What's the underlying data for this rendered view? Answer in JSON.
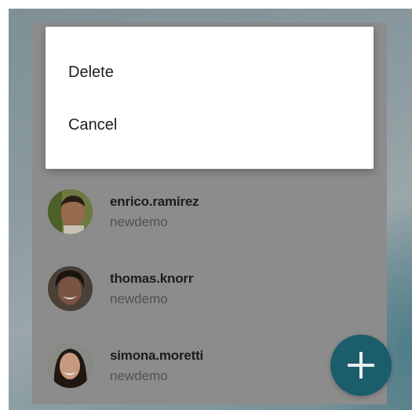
{
  "context_menu": {
    "items": [
      {
        "label": "Delete"
      },
      {
        "label": "Cancel"
      }
    ]
  },
  "users": [
    {
      "name": "enrico.ramirez",
      "org": "newdemo",
      "avatar": "man-short-hair"
    },
    {
      "name": "thomas.knorr",
      "org": "newdemo",
      "avatar": "man-smiling"
    },
    {
      "name": "simona.moretti",
      "org": "newdemo",
      "avatar": "woman-dark-hair"
    }
  ],
  "fab": {
    "icon": "plus-icon",
    "color": "#1c5d6c"
  },
  "colors": {
    "scrim_card": "#8c8c8c",
    "menu_background": "#ffffff"
  }
}
